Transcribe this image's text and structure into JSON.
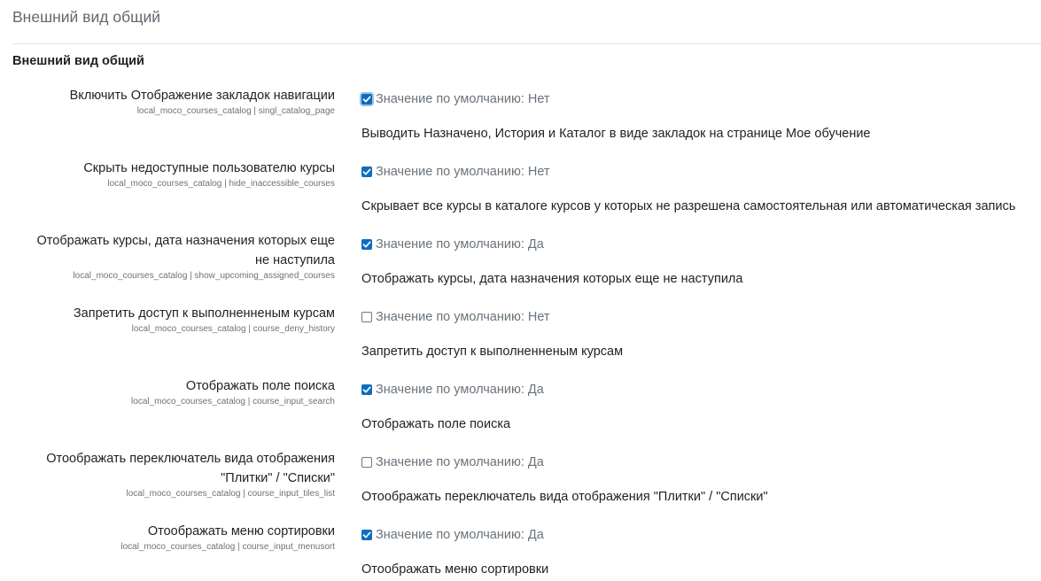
{
  "page": {
    "title": "Внешний вид общий",
    "section_heading": "Внешний вид общий"
  },
  "settings": [
    {
      "name": "Включить Отображение закладок навигации",
      "id": "local_moco_courses_catalog | singl_catalog_page",
      "checked": true,
      "focused": true,
      "default": "Значение по умолчанию: Нет",
      "description": "Выводить Назначено, История и Каталог в виде закладок на странице Мое обучение"
    },
    {
      "name": "Скрыть недоступные пользователю курсы",
      "id": "local_moco_courses_catalog | hide_inaccessible_courses",
      "checked": true,
      "focused": false,
      "default": "Значение по умолчанию: Нет",
      "description": "Скрывает все курсы в каталоге курсов у которых не разрешена самостоятельная или автоматическая запись"
    },
    {
      "name_line1": "Отображать курсы, дата назначения которых еще",
      "name_line2": "не наступила",
      "id": "local_moco_courses_catalog | show_upcoming_assigned_courses",
      "checked": true,
      "focused": false,
      "default": "Значение по умолчанию: Да",
      "description": "Отображать курсы, дата назначения которых еще не наступила"
    },
    {
      "name": "Запретить доступ к выполненненым курсам",
      "id": "local_moco_courses_catalog | course_deny_history",
      "checked": false,
      "focused": false,
      "default": "Значение по умолчанию: Нет",
      "description": "Запретить доступ к выполненненым курсам"
    },
    {
      "name": "Отображать поле поиска",
      "id": "local_moco_courses_catalog | course_input_search",
      "checked": true,
      "focused": false,
      "default": "Значение по умолчанию: Да",
      "description": "Отображать поле поиска"
    },
    {
      "name_line1": "Отоображать переключатель вида отображения",
      "name_line2": "\"Плитки\" / \"Списки\"",
      "id": "local_moco_courses_catalog | course_input_tiles_list",
      "checked": false,
      "focused": false,
      "default": "Значение по умолчанию: Да",
      "description": "Отоображать переключатель вида отображения \"Плитки\" / \"Списки\""
    },
    {
      "name": "Отоображать меню сортировки",
      "id": "local_moco_courses_catalog | course_input_menusort",
      "checked": true,
      "focused": false,
      "default": "Значение по умолчанию: Да",
      "description": "Отоображать меню сортировки"
    }
  ],
  "colors": {
    "checkbox_accent": "#0f6cbf",
    "focus_ring": "#9cc2e8",
    "muted_text": "#6a737b"
  },
  "icons": {
    "checkbox_mark": "checkmark-icon"
  }
}
